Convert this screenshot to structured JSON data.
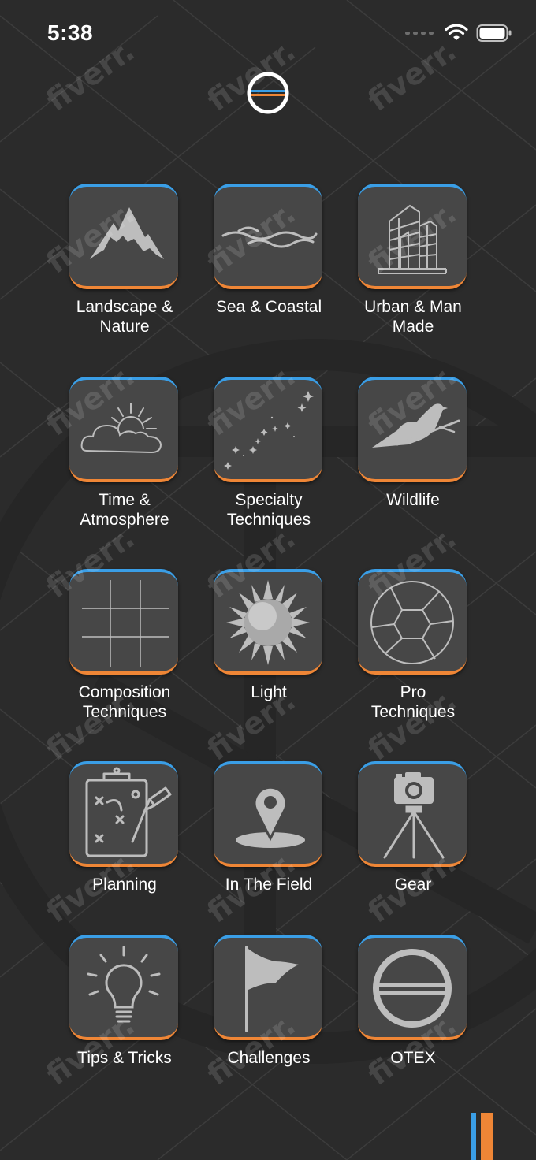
{
  "status_bar": {
    "time": "5:38"
  },
  "header": {
    "logo_icon": "otex-logo-icon"
  },
  "tiles": [
    {
      "label": "Landscape &\nNature",
      "icon": "mountain-icon"
    },
    {
      "label": "Sea & Coastal",
      "icon": "waves-icon"
    },
    {
      "label": "Urban & Man\nMade",
      "icon": "buildings-icon"
    },
    {
      "label": "Time &\nAtmosphere",
      "icon": "sun-cloud-icon"
    },
    {
      "label": "Specialty\nTechniques",
      "icon": "stars-icon"
    },
    {
      "label": "Wildlife",
      "icon": "bird-icon"
    },
    {
      "label": "Composition\nTechniques",
      "icon": "grid-icon"
    },
    {
      "label": "Light",
      "icon": "sun-icon"
    },
    {
      "label": "Pro\nTechniques",
      "icon": "aperture-icon"
    },
    {
      "label": "Planning",
      "icon": "clipboard-plan-icon"
    },
    {
      "label": "In The Field",
      "icon": "location-pin-icon"
    },
    {
      "label": "Gear",
      "icon": "camera-tripod-icon"
    },
    {
      "label": "Tips & Tricks",
      "icon": "lightbulb-icon"
    },
    {
      "label": "Challenges",
      "icon": "flag-icon"
    },
    {
      "label": "OTEX",
      "icon": "otex-logo-icon"
    }
  ],
  "watermark": {
    "text": "fiverr."
  },
  "colors": {
    "accent_blue": "#3a9ee6",
    "accent_orange": "#ef8636",
    "background": "#2b2b2b",
    "tile": "#474747",
    "icon_gray": "#bdbdbd"
  }
}
